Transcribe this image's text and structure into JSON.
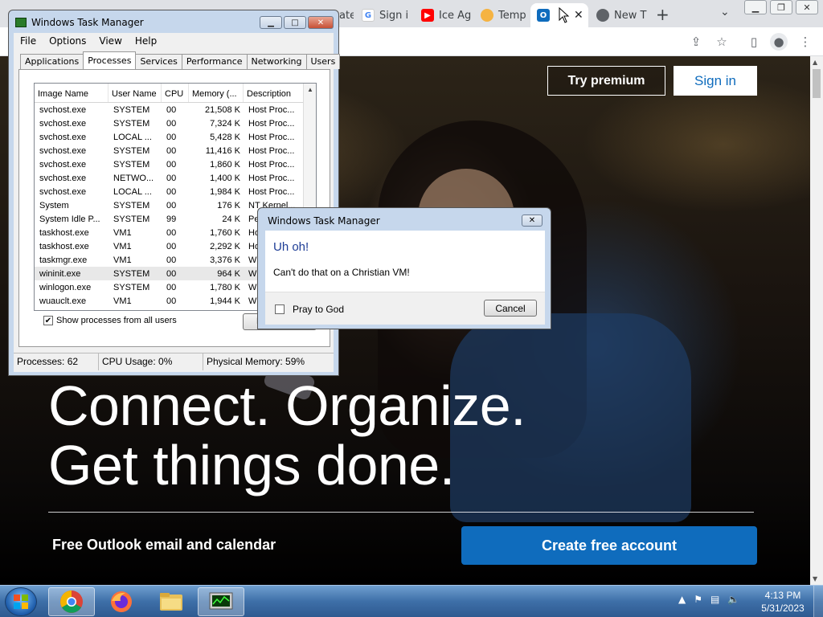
{
  "browser": {
    "tabs": [
      {
        "label": "ate",
        "favicon": "generic-icon",
        "color": "#9aa0a6"
      },
      {
        "label": "Sign i",
        "favicon": "google-icon",
        "color": "#4285f4"
      },
      {
        "label": "Ice Ag",
        "favicon": "youtube-icon",
        "color": "#ff0000"
      },
      {
        "label": "Temp",
        "favicon": "temp-mail-icon",
        "color": "#f5b342"
      },
      {
        "label": "",
        "favicon": "outlook-icon",
        "color": "#0f6cbd"
      },
      {
        "label": "New T",
        "favicon": "chrome-icon",
        "color": "#5f6368"
      }
    ],
    "new_tab_symbol": "+",
    "tab_search_symbol": "⌄"
  },
  "outlook": {
    "try_premium": "Try premium",
    "sign_in": "Sign in",
    "hero_line1": "Connect. Organize.",
    "hero_line2": "Get things done.",
    "tagline": "Free Outlook email and calendar",
    "create_account": "Create free account",
    "accent": "#0f6cbd"
  },
  "task_manager": {
    "title": "Windows Task Manager",
    "menu": [
      "File",
      "Options",
      "View",
      "Help"
    ],
    "tabs": [
      "Applications",
      "Processes",
      "Services",
      "Performance",
      "Networking",
      "Users"
    ],
    "active_tab": "Processes",
    "columns": [
      "Image Name",
      "User Name",
      "CPU",
      "Memory (...",
      "Description"
    ],
    "rows": [
      [
        "svchost.exe",
        "SYSTEM",
        "00",
        "21,508 K",
        "Host Proc..."
      ],
      [
        "svchost.exe",
        "SYSTEM",
        "00",
        "7,324 K",
        "Host Proc..."
      ],
      [
        "svchost.exe",
        "LOCAL ...",
        "00",
        "5,428 K",
        "Host Proc..."
      ],
      [
        "svchost.exe",
        "SYSTEM",
        "00",
        "11,416 K",
        "Host Proc..."
      ],
      [
        "svchost.exe",
        "SYSTEM",
        "00",
        "1,860 K",
        "Host Proc..."
      ],
      [
        "svchost.exe",
        "NETWO...",
        "00",
        "1,400 K",
        "Host Proc..."
      ],
      [
        "svchost.exe",
        "LOCAL ...",
        "00",
        "1,984 K",
        "Host Proc..."
      ],
      [
        "System",
        "SYSTEM",
        "00",
        "176 K",
        "NT Kernel..."
      ],
      [
        "System Idle P...",
        "SYSTEM",
        "99",
        "24 K",
        "Perc..."
      ],
      [
        "taskhost.exe",
        "VM1",
        "00",
        "1,760 K",
        "Host..."
      ],
      [
        "taskhost.exe",
        "VM1",
        "00",
        "2,292 K",
        "Host..."
      ],
      [
        "taskmgr.exe",
        "VM1",
        "00",
        "3,376 K",
        "Win..."
      ],
      [
        "wininit.exe",
        "SYSTEM",
        "00",
        "964 K",
        "Win..."
      ],
      [
        "winlogon.exe",
        "SYSTEM",
        "00",
        "1,780 K",
        "Win..."
      ],
      [
        "wuauclt.exe",
        "VM1",
        "00",
        "1,944 K",
        "Win..."
      ]
    ],
    "selected_row": "wininit.exe",
    "show_all_label": "Show processes from all users",
    "show_all_checked": "✔",
    "end_process": "End Process",
    "status_processes": "Processes: 62",
    "status_cpu": "CPU Usage: 0%",
    "status_memory": "Physical Memory: 59%"
  },
  "dialog": {
    "title": "Windows Task Manager",
    "heading": "Uh oh!",
    "message": "Can't do that on a Christian VM!",
    "checkbox_label": "Pray to God",
    "cancel": "Cancel"
  },
  "taskbar": {
    "apps": [
      "chrome-icon",
      "firefox-icon",
      "explorer-folder-icon",
      "task-manager-icon"
    ],
    "time": "4:13 PM",
    "date": "5/31/2023"
  }
}
